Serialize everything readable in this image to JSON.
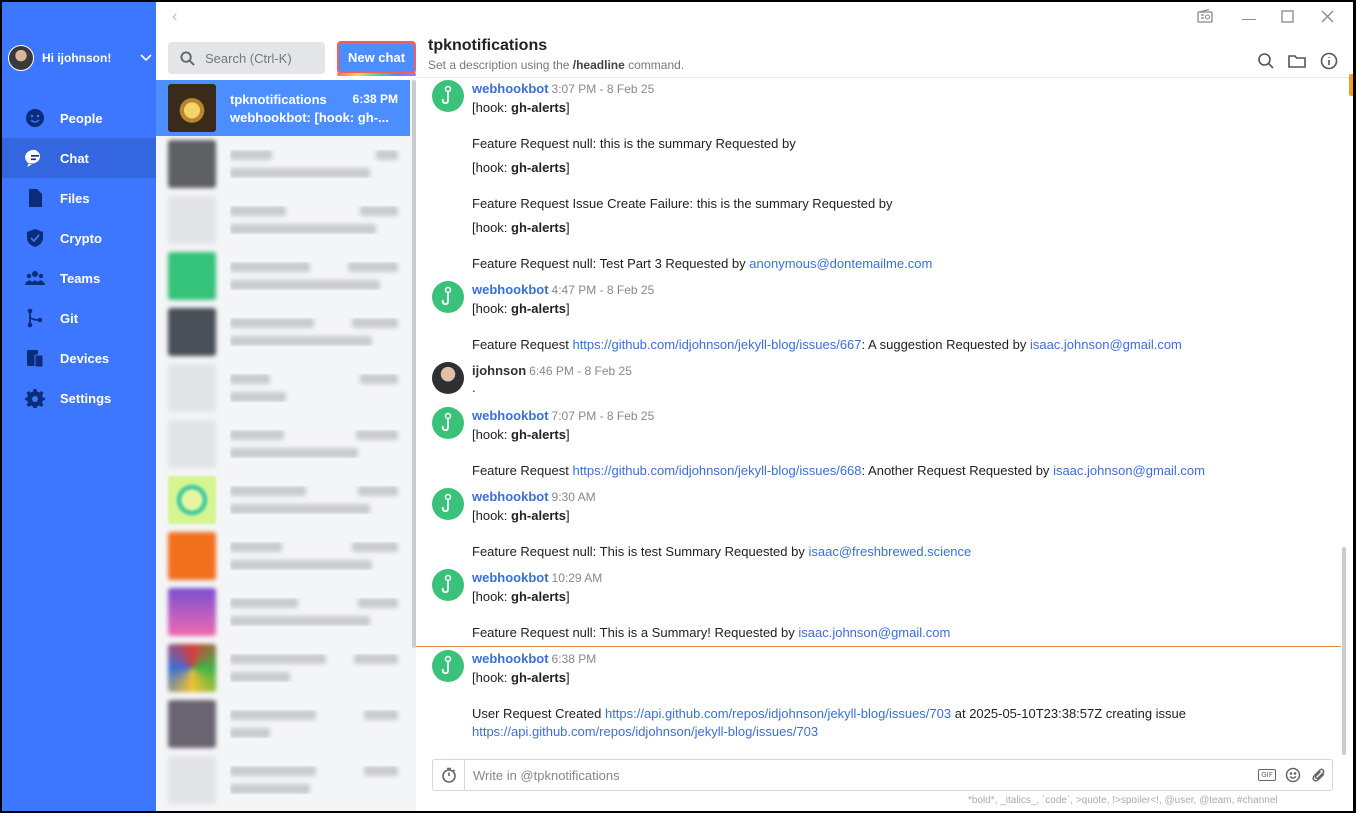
{
  "user": {
    "greeting": "Hi ijohnson!"
  },
  "nav": {
    "items": [
      {
        "label": "People",
        "icon": "people-icon"
      },
      {
        "label": "Chat",
        "icon": "chat-icon",
        "active": true
      },
      {
        "label": "Files",
        "icon": "files-icon"
      },
      {
        "label": "Crypto",
        "icon": "crypto-icon"
      },
      {
        "label": "Teams",
        "icon": "teams-icon"
      },
      {
        "label": "Git",
        "icon": "git-icon"
      },
      {
        "label": "Devices",
        "icon": "devices-icon"
      },
      {
        "label": "Settings",
        "icon": "settings-icon"
      }
    ]
  },
  "search": {
    "placeholder": "Search (Ctrl-K)"
  },
  "new_chat_label": "New chat",
  "conversations": {
    "active": {
      "name": "tpknotifications",
      "time": "6:38 PM",
      "snippet": "webhookbot: [hook: gh-..."
    }
  },
  "channel": {
    "title": "tpknotifications",
    "subtitle_prefix": "Set a description using the",
    "subtitle_cmd": "/headline",
    "subtitle_suffix": "command."
  },
  "messages": {
    "m1": {
      "author": "webhookbot",
      "time": "3:07 PM - 8 Feb 25"
    },
    "m2": {
      "author": "webhookbot",
      "time": "4:47 PM - 8 Feb 25"
    },
    "m3": {
      "author": "ijohnson",
      "time": "6:46 PM - 8 Feb 25",
      "text": "."
    },
    "m4": {
      "author": "webhookbot",
      "time": "7:07 PM - 8 Feb 25"
    },
    "m5": {
      "author": "webhookbot",
      "time": "9:30 AM"
    },
    "m6": {
      "author": "webhookbot",
      "time": "10:29 AM"
    },
    "m7": {
      "author": "webhookbot",
      "time": "6:38 PM"
    },
    "hook_prefix": "[hook: ",
    "hook_name": "gh-alerts",
    "hook_suffix": "]",
    "lines": {
      "fr_summary": "Feature Request null: this is the summary Requested by",
      "fr_issue_fail": "Feature Request Issue Create Failure: this is the summary Requested by",
      "fr_test3": "Feature Request null: Test Part 3 Requested by",
      "fr_test3_email": "anonymous@dontemailme.com",
      "fr_667_prefix": "Feature Request",
      "fr_667_link": "https://github.com/idjohnson/jekyll-blog/issues/667",
      "fr_667_mid": ": A suggestion Requested by",
      "email_isaac": "isaac.johnson@gmail.com",
      "fr_668_prefix": "Feature Request",
      "fr_668_link": "https://github.com/idjohnson/jekyll-blog/issues/668",
      "fr_668_mid": ": Another Request Requested by",
      "fr_test_summary": "Feature Request null: This is test Summary Requested by",
      "fr_test_summary_email": "isaac@freshbrewed.science",
      "fr_summary2": "Feature Request null: This is a Summary! Requested by",
      "ur_prefix": "User Request Created",
      "ur_link": "https://api.github.com/repos/idjohnson/jekyll-blog/issues/703",
      "ur_mid": "at 2025-05-10T23:38:57Z creating issue",
      "ur_link2": "https://api.github.com/repos/idjohnson/jekyll-blog/issues/703"
    }
  },
  "composer": {
    "placeholder": "Write in @tpknotifications",
    "gif_label": "GIF"
  },
  "hint": "*bold*, _italics_, `code`, >quote, !>spoiler<!, @user, @team, #channel",
  "colors": {
    "nav": "#3d76ff",
    "accent": "#4c8eff",
    "bot_avatar": "#3bc27a",
    "new_divider": "#e8894a"
  }
}
